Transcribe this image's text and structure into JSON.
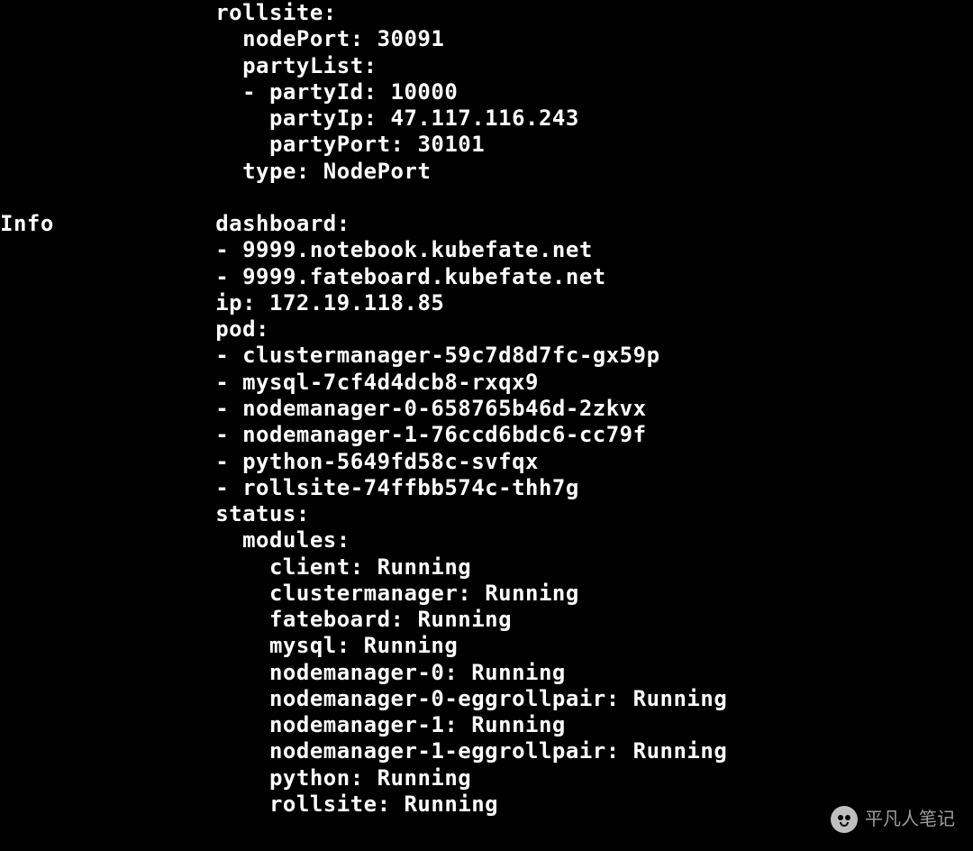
{
  "config": {
    "rollsite": {
      "label": "rollsite:",
      "nodePort": {
        "label": "nodePort:",
        "value": "30091"
      },
      "partyList": {
        "label": "partyList:",
        "entry": {
          "partyId": {
            "label": "partyId:",
            "value": "10000"
          },
          "partyIp": {
            "label": "partyIp:",
            "value": "47.117.116.243"
          },
          "partyPort": {
            "label": "partyPort:",
            "value": "30101"
          }
        }
      },
      "type": {
        "label": "type:",
        "value": "NodePort"
      }
    }
  },
  "info": {
    "label": "Info",
    "dashboard": {
      "label": "dashboard:",
      "items": [
        "9999.notebook.kubefate.net",
        "9999.fateboard.kubefate.net"
      ]
    },
    "ip": {
      "label": "ip:",
      "value": "172.19.118.85"
    },
    "pod": {
      "label": "pod:",
      "items": [
        "clustermanager-59c7d8d7fc-gx59p",
        "mysql-7cf4d4dcb8-rxqx9",
        "nodemanager-0-658765b46d-2zkvx",
        "nodemanager-1-76ccd6bdc6-cc79f",
        "python-5649fd58c-svfqx",
        "rollsite-74ffbb574c-thh7g"
      ]
    },
    "status": {
      "label": "status:",
      "modules": {
        "label": "modules:",
        "items": [
          {
            "name": "client",
            "state": "Running"
          },
          {
            "name": "clustermanager",
            "state": "Running"
          },
          {
            "name": "fateboard",
            "state": "Running"
          },
          {
            "name": "mysql",
            "state": "Running"
          },
          {
            "name": "nodemanager-0",
            "state": "Running"
          },
          {
            "name": "nodemanager-0-eggrollpair",
            "state": "Running"
          },
          {
            "name": "nodemanager-1",
            "state": "Running"
          },
          {
            "name": "nodemanager-1-eggrollpair",
            "state": "Running"
          },
          {
            "name": "python",
            "state": "Running"
          },
          {
            "name": "rollsite",
            "state": "Running"
          }
        ]
      }
    }
  },
  "watermark": {
    "text": "平凡人笔记"
  }
}
